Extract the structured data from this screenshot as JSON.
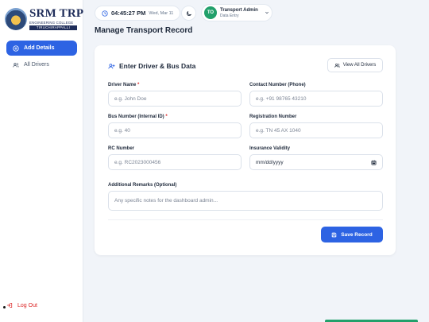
{
  "logo": {
    "name": "SRM TRP",
    "subtitle": "ENGINEERING COLLEGE",
    "location": "TIRUCHIRAPPALLI"
  },
  "sidebar": {
    "items": [
      {
        "label": "Add Details",
        "icon": "plus-circle-icon",
        "active": true
      },
      {
        "label": "All Drivers",
        "icon": "users-icon",
        "active": false
      }
    ],
    "logout_label": "Log Out"
  },
  "topbar": {
    "time": "04:45:27 PM",
    "date": "Wed, Mar 11",
    "user_name": "Transport Admin",
    "user_role": "Data Entry",
    "avatar_initials": "TO"
  },
  "page_title": "Manage Transport Record",
  "form": {
    "heading": "Enter Driver & Bus Data",
    "view_all_label": "View All Drivers",
    "fields": {
      "driver_name": {
        "label": "Driver Name",
        "required_mark": "*",
        "placeholder": "e.g. John Doe"
      },
      "contact_number": {
        "label": "Contact Number (Phone)",
        "placeholder": "e.g. +91 98765 43210"
      },
      "bus_number": {
        "label": "Bus Number (Internal ID)",
        "required_mark": "*",
        "placeholder": "e.g. 40"
      },
      "registration_number": {
        "label": "Registration Number",
        "placeholder": "e.g. TN 45 AX 1040"
      },
      "rc_number": {
        "label": "RC Number",
        "placeholder": "e.g. RC2023000456"
      },
      "insurance_validity": {
        "label": "Insurance Validity",
        "value": "mm/dd/yyyy"
      },
      "remarks": {
        "label": "Additional Remarks (Optional)",
        "placeholder": "Any specific notes for the dashboard admin..."
      }
    },
    "save_label": "Save Record"
  },
  "colors": {
    "accent": "#2d63e3",
    "avatar": "#22a06b",
    "danger": "#dc2626",
    "background": "#f1f4f9"
  }
}
